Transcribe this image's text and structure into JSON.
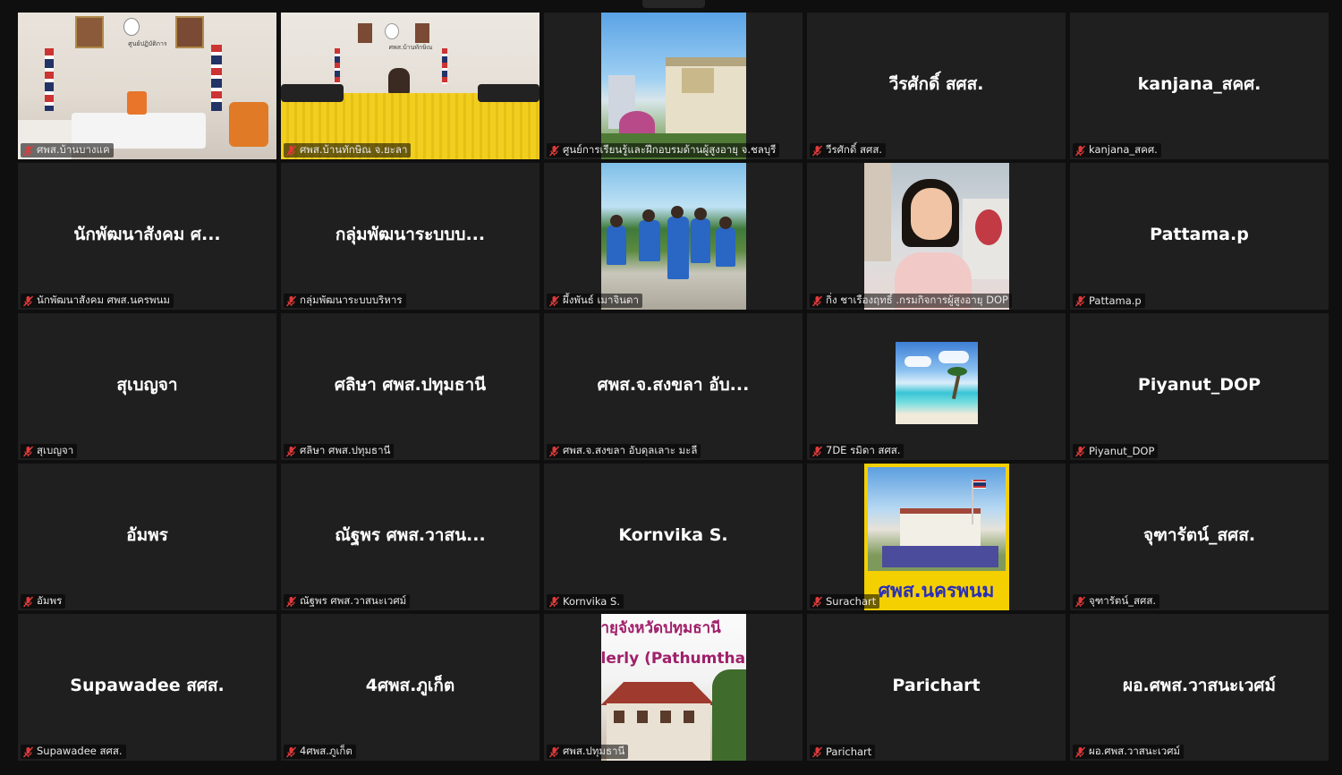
{
  "colors": {
    "background": "#0f0f0f",
    "tile": "#1f1f1f",
    "mic_muted": "#e03a3a",
    "name_text": "#ffffff"
  },
  "tiles": [
    {
      "center_name": "",
      "label": "ศพส.บ้านบางแค",
      "type": "video"
    },
    {
      "center_name": "",
      "label": "ศพส.บ้านทักษิณ จ.ยะลา",
      "type": "video"
    },
    {
      "center_name": "",
      "label": "ศูนย์การเรียนรู้และฝึกอบรมด้านผู้สูงอายุ จ.ชลบุรี",
      "type": "photo"
    },
    {
      "center_name": "วีรศักดิ์ สศส.",
      "label": "วีรศักดิ์ สศส.",
      "type": "name"
    },
    {
      "center_name": "kanjana_สคศ.",
      "label": "kanjana_สคศ.",
      "type": "name"
    },
    {
      "center_name": "นักพัฒนาสังคม ศ...",
      "label": "นักพัฒนาสังคม ศพส.นครพนม",
      "type": "name"
    },
    {
      "center_name": "กลุ่มพัฒนาระบบบ...",
      "label": "กลุ่มพัฒนาระบบบริหาร",
      "type": "name"
    },
    {
      "center_name": "",
      "label": "ผึ้งพันธ์ เมาจินดา",
      "type": "photo"
    },
    {
      "center_name": "",
      "label": "กิ่ง ชาเรืองฤทธิ์ .กรมกิจการผู้สูงอายุ DOP",
      "type": "photo"
    },
    {
      "center_name": "Pattama.p",
      "label": "Pattama.p",
      "type": "name"
    },
    {
      "center_name": "สุเบญจา",
      "label": "สุเบญจา",
      "type": "name"
    },
    {
      "center_name": "ศลิษา ศพส.ปทุมธานี",
      "label": "ศลิษา ศพส.ปทุมธานี",
      "type": "name"
    },
    {
      "center_name": "ศพส.จ.สงขลา อับ...",
      "label": "ศพส.จ.สงขลา อับดุลเลาะ มะลี",
      "type": "name"
    },
    {
      "center_name": "",
      "label": "7DE รมิดา สศส.",
      "type": "photo"
    },
    {
      "center_name": "Piyanut_DOP",
      "label": "Piyanut_DOP",
      "type": "name"
    },
    {
      "center_name": "อัมพร",
      "label": "อัมพร",
      "type": "name"
    },
    {
      "center_name": "ณัฐพร ศพส.วาสน...",
      "label": "ณัฐพร ศพส.วาสนะเวศม์",
      "type": "name"
    },
    {
      "center_name": "Kornvika S.",
      "label": "Kornvika S.",
      "type": "name"
    },
    {
      "center_name": "",
      "label": "Surachart",
      "type": "photo",
      "overlay_text": "ศพส.นครพนม"
    },
    {
      "center_name": "จุฑารัตน์_สศส.",
      "label": "จุฑารัตน์_สศส.",
      "type": "name"
    },
    {
      "center_name": "Supawadee สศส.",
      "label": "Supawadee สศส.",
      "type": "name"
    },
    {
      "center_name": "4ศพส.ภูเก็ต",
      "label": "4ศพส.ภูเก็ต",
      "type": "name"
    },
    {
      "center_name": "",
      "label": "ศพส.ปทุมธานี",
      "type": "photo",
      "overlay_text_1": "ายุจังหวัดปทุมธานี",
      "overlay_text_2": "lerly (Pathumthani"
    },
    {
      "center_name": "Parichart",
      "label": "Parichart",
      "type": "name"
    },
    {
      "center_name": "ผอ.ศพส.วาสนะเวศม์",
      "label": "ผอ.ศพส.วาสนะเวศม์",
      "type": "name"
    }
  ],
  "room_signs": {
    "tile0": "ศูนย์ปฏิบัติการ",
    "tile1": "ศพส.บ้านทักษิณ"
  },
  "icons": {
    "mic": "mic-muted-icon"
  }
}
